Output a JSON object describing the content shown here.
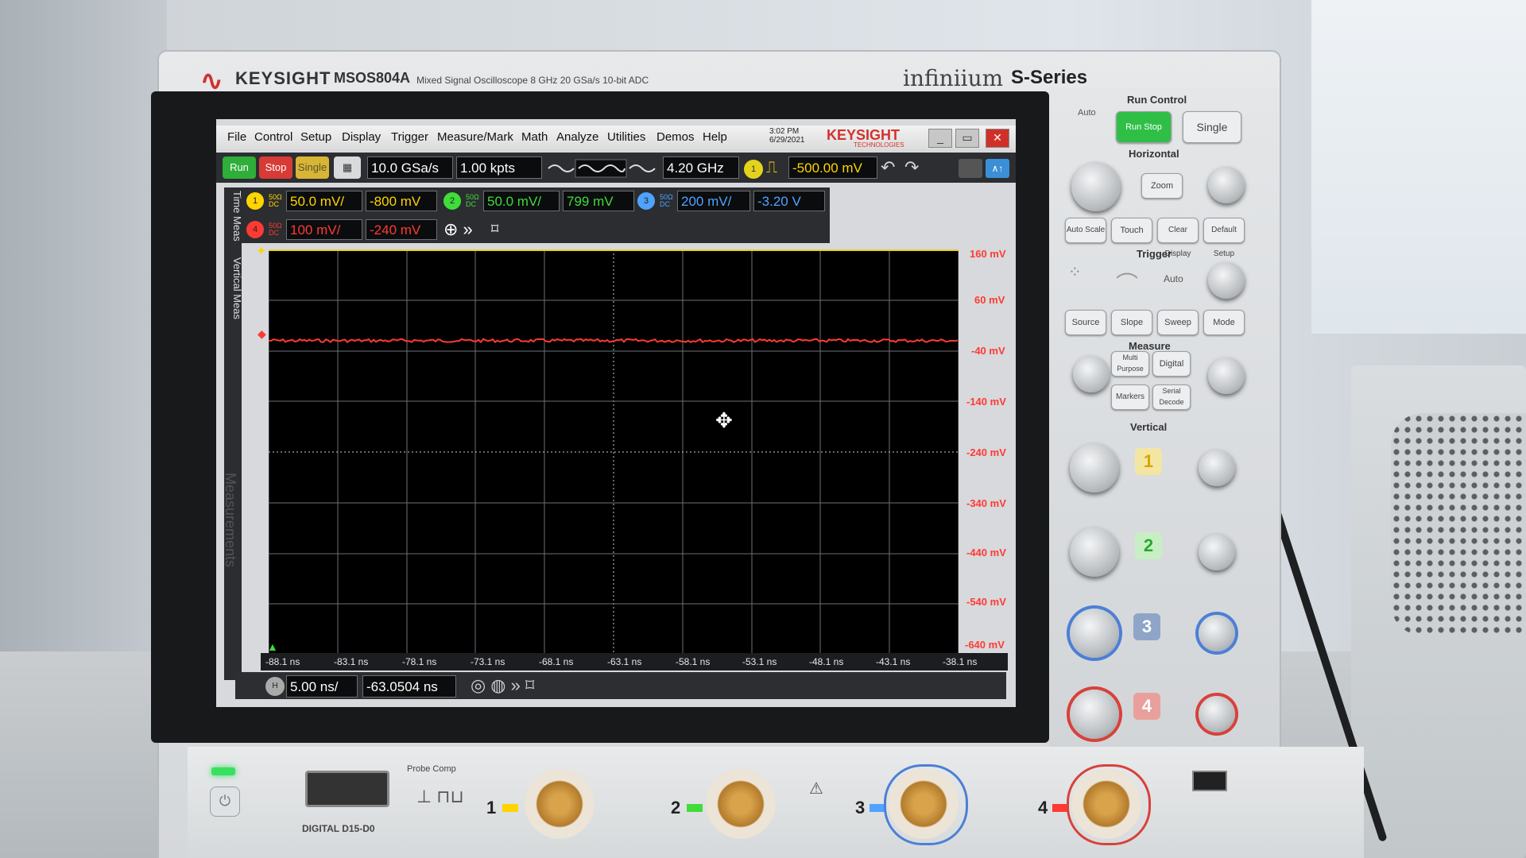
{
  "instrument": {
    "brand": "KEYSIGHT",
    "model": "MSOS804A",
    "description": "Mixed Signal Oscilloscope   8 GHz   20 GSa/s   10-bit ADC",
    "product_line": "infiniium",
    "series": "S-Series"
  },
  "menu": {
    "items": [
      "File",
      "Control",
      "Setup",
      "Display",
      "Trigger",
      "Measure/Mark",
      "Math",
      "Analyze",
      "Utilities",
      "Demos",
      "Help"
    ],
    "time": "3:02 PM",
    "date": "6/29/2021",
    "logo": "KEYSIGHT",
    "logo_sub": "TECHNOLOGIES"
  },
  "toolbar": {
    "run": "Run",
    "stop": "Stop",
    "single": "Single",
    "sample_rate": "10.0 GSa/s",
    "points": "1.00 kpts",
    "bandwidth": "4.20 GHz",
    "trigger_source": "1",
    "trigger_level": "-500.00 mV"
  },
  "channels": [
    {
      "id": "1",
      "coupling": "50Ω DC",
      "scale": "50.0 mV/",
      "offset": "-800 mV",
      "color": "#ffd400"
    },
    {
      "id": "2",
      "coupling": "50Ω DC",
      "scale": "50.0 mV/",
      "offset": "799 mV",
      "color": "#3fdc3a"
    },
    {
      "id": "3",
      "coupling": "50Ω DC",
      "scale": "200 mV/",
      "offset": "-3.20 V",
      "color": "#4fa3ff"
    },
    {
      "id": "4",
      "coupling": "50Ω DC",
      "scale": "100 mV/",
      "offset": "-240 mV",
      "color": "#ff3a34"
    }
  ],
  "side_tabs": [
    "Time Meas",
    "Vertical Meas"
  ],
  "measurements_label": "Measurements",
  "plot": {
    "y_labels": [
      "160 mV",
      "60 mV",
      "-40 mV",
      "-140 mV",
      "-240 mV",
      "-340 mV",
      "-440 mV",
      "-540 mV",
      "-640 mV"
    ],
    "x_labels": [
      "-88.1 ns",
      "-83.1 ns",
      "-78.1 ns",
      "-73.1 ns",
      "-68.1 ns",
      "-63.1 ns",
      "-58.1 ns",
      "-53.1 ns",
      "-48.1 ns",
      "-43.1 ns",
      "-38.1 ns"
    ],
    "trace_color": "#ff3a34",
    "trace_level_mv": -20
  },
  "timebase": {
    "scale": "5.00 ns/",
    "position": "-63.0504 ns"
  },
  "front_panel": {
    "run_control_title": "Run Control",
    "auto_label": "Auto",
    "run_stop": "Run Stop",
    "single": "Single",
    "horizontal_title": "Horizontal",
    "zoom": "Zoom",
    "auto_scale": "Auto Scale",
    "touch": "Touch",
    "clear_display": "Clear Display",
    "default_setup": "Default Setup",
    "trigger_title": "Trigger",
    "trigger_auto": "Auto",
    "source": "Source",
    "slope": "Slope",
    "sweep": "Sweep",
    "mode": "Mode",
    "measure_title": "Measure",
    "multi_purpose": "Multi Purpose",
    "digital": "Digital",
    "markers": "Markers",
    "serial_decode": "Serial Decode",
    "vertical_title": "Vertical",
    "ch_keys": [
      "1",
      "2",
      "3",
      "4"
    ]
  },
  "inputs": {
    "digital": "DIGITAL D15-D0",
    "probe_comp": "Probe Comp",
    "labels": [
      "1",
      "2",
      "3",
      "4"
    ]
  }
}
